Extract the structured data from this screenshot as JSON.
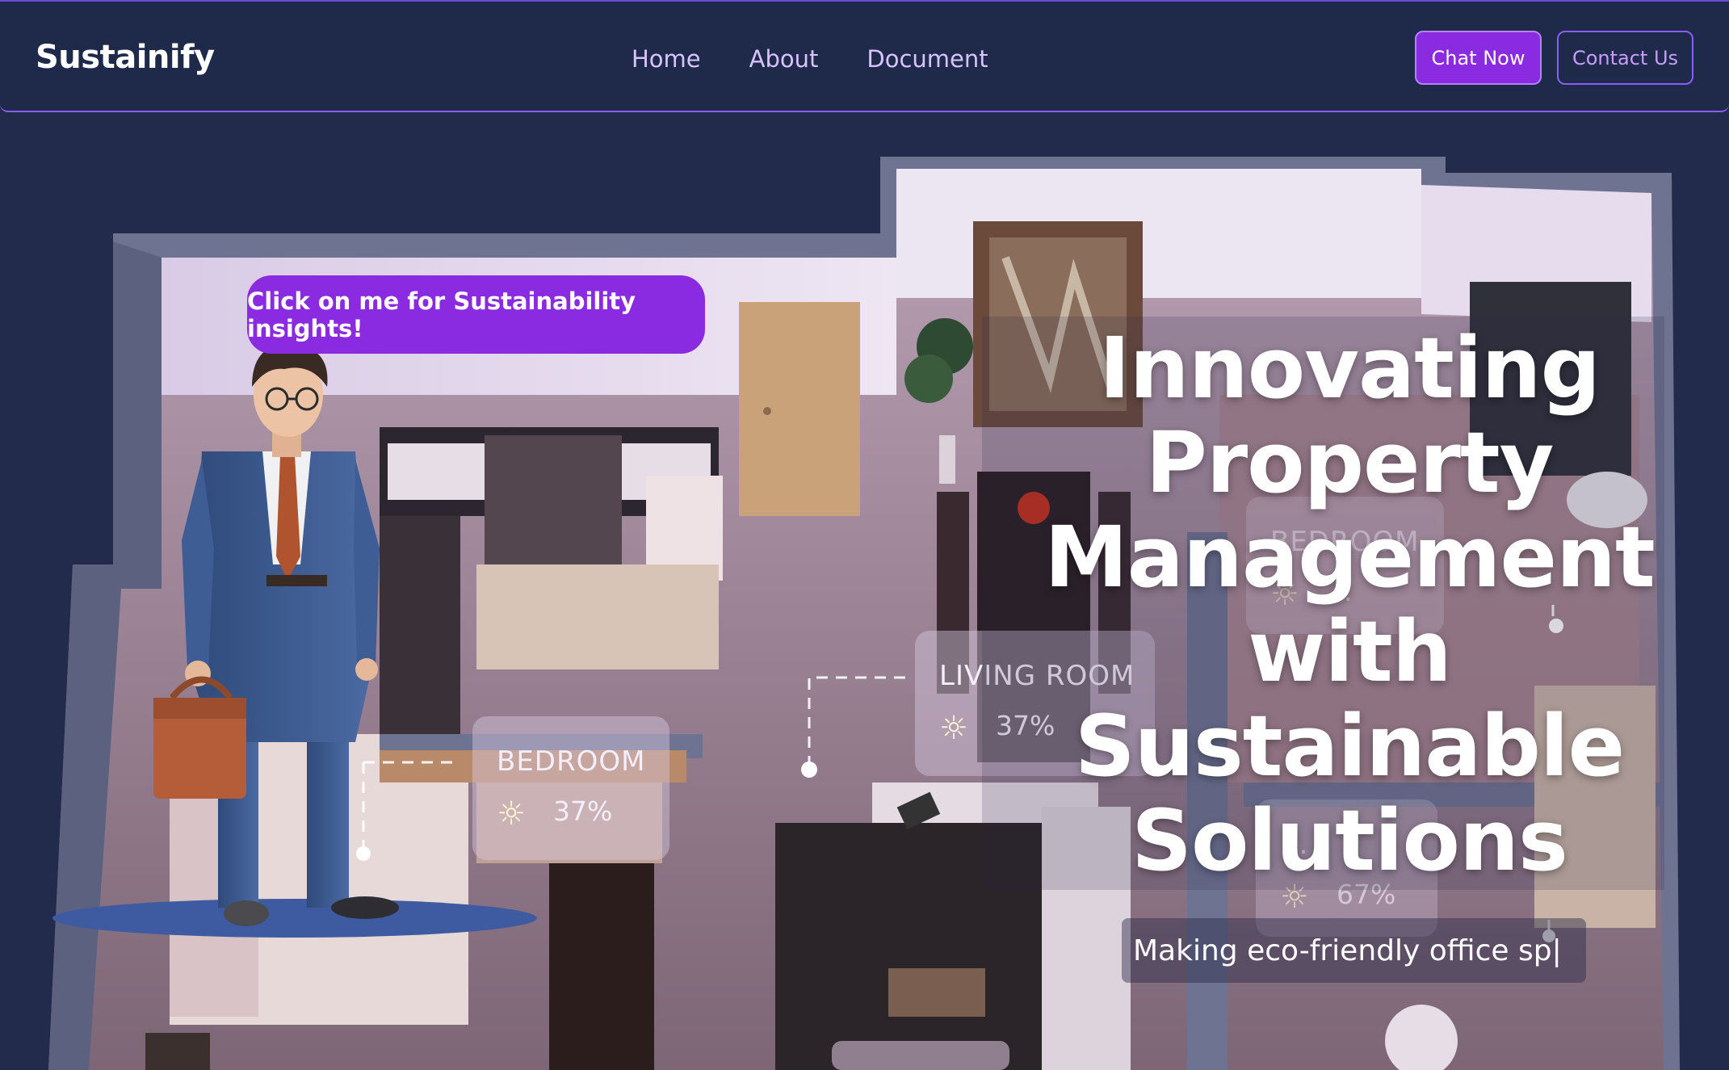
{
  "navbar": {
    "brand": "Sustainify",
    "links": [
      "Home",
      "About",
      "Document"
    ],
    "chat_button": "Chat Now",
    "contact_button": "Contact Us"
  },
  "hero": {
    "assistant_bubble": "Click on me for Sustainability insights!",
    "headline_lines": [
      "Innovating",
      "Property",
      "Management",
      "with",
      "Sustainable",
      "Solutions"
    ],
    "subheadline": "Making eco-friendly office sp|",
    "room_cards": [
      {
        "name": "BEDROOM",
        "value": "37%"
      },
      {
        "name": "LIVING ROOM",
        "value": "37%"
      },
      {
        "name": "BEDROOM",
        "value": "..."
      },
      {
        "name": "...",
        "value": "67%"
      }
    ]
  },
  "colors": {
    "background": "#232b4d",
    "navbar": "#1f2a4b",
    "accent": "#8a2be2",
    "nav_link": "#d8c2ff"
  },
  "icons": [
    "sun-icon",
    "assistant-avatar"
  ]
}
